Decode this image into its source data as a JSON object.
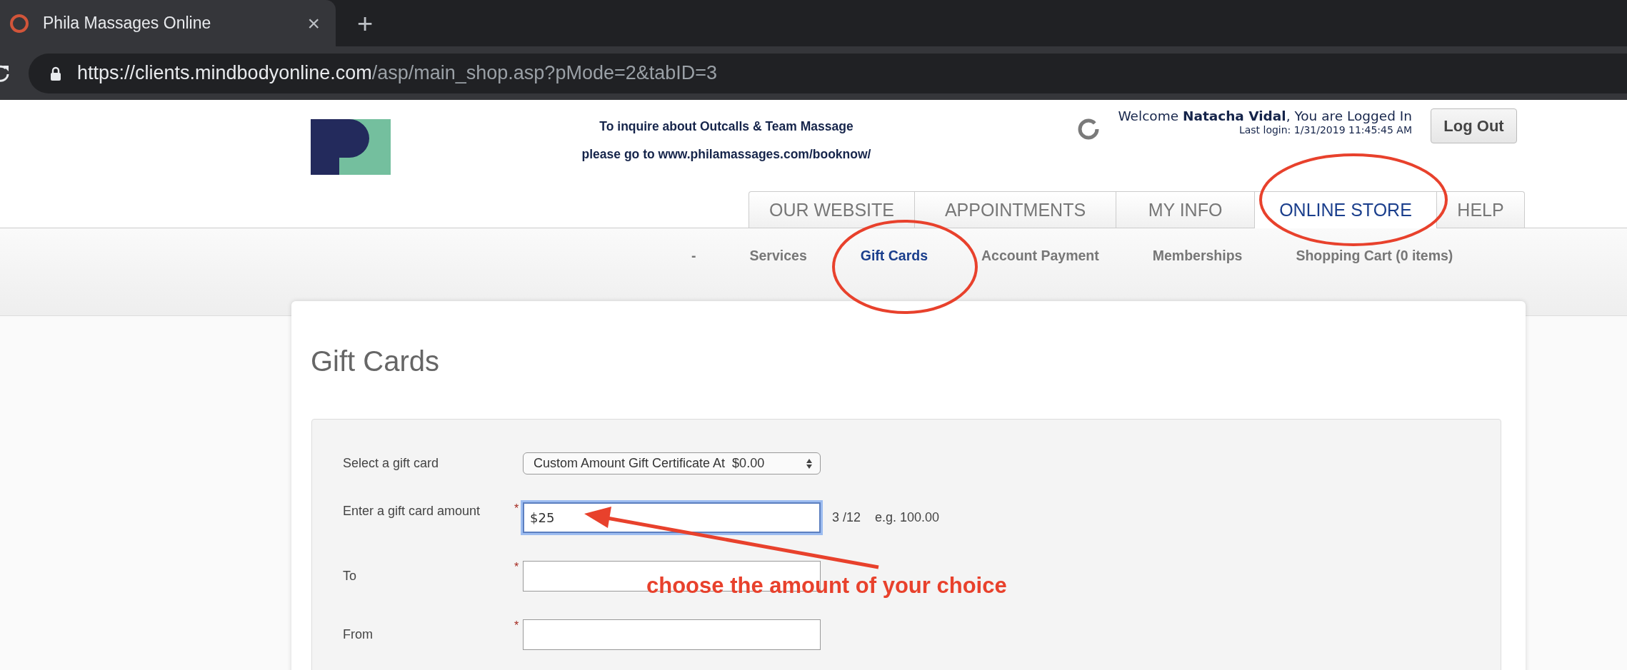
{
  "browser": {
    "tab_title": "Phila Massages Online",
    "close": "×",
    "new_tab": "+",
    "address": {
      "host": "https://clients.mindbodyonline.com",
      "path": "/asp/main_shop.asp?pMode=2&tabID=3"
    }
  },
  "header": {
    "notice": [
      "To inquire about Outcalls & Team Massage",
      "please go to www.philamassages.com/booknow/"
    ],
    "welcome": "Welcome **Natacha Vidal**, You are Logged In",
    "last_login": "Last login: 1/31/2019 11:45:45 AM",
    "logout": "Log Out"
  },
  "tabs": [
    {
      "label": "OUR WEBSITE",
      "selected": false
    },
    {
      "label": "APPOINTMENTS",
      "selected": false
    },
    {
      "label": "MY INFO",
      "selected": false
    },
    {
      "label": "ONLINE STORE",
      "selected": true
    },
    {
      "label": "HELP",
      "selected": false
    }
  ],
  "subnav": [
    {
      "label": "-",
      "selected": false
    },
    {
      "label": "Services",
      "selected": false
    },
    {
      "label": "Gift Cards",
      "selected": true
    },
    {
      "label": "Account Payment",
      "selected": false
    },
    {
      "label": "Memberships",
      "selected": false
    },
    {
      "label": "Shopping Cart (0 items)",
      "selected": false
    }
  ],
  "page_title": "Gift Cards",
  "form": {
    "fields": [
      {
        "kind": "select",
        "label": "Select a gift card",
        "value": "Custom Amount Gift Certificate At  $0.00"
      },
      {
        "kind": "text",
        "label": "Enter a gift card amount",
        "asterisk": "*",
        "value": "$25",
        "focused": true,
        "counter": "3 /12",
        "hint": "e.g. 100.00"
      },
      {
        "kind": "text",
        "label": "To",
        "asterisk": "*",
        "focused": false
      },
      {
        "kind": "text",
        "label": "From",
        "asterisk": "*",
        "focused": false
      }
    ]
  },
  "annotation": {
    "text": "choose the amount of your choice"
  }
}
